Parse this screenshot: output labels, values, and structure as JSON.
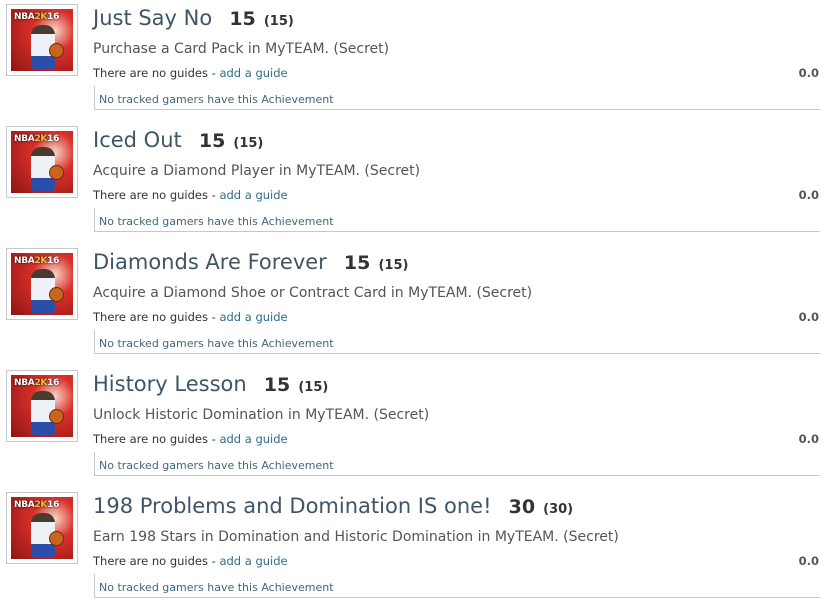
{
  "achievements": [
    {
      "title": "Just Say No",
      "score": "15",
      "score_paren": "(15)",
      "description": "Purchase a Card Pack in MyTEAM. (Secret)",
      "guides_text": "There are no guides - ",
      "guide_link": "add a guide",
      "ratio": "0.0",
      "tracked": "No tracked gamers have this Achievement"
    },
    {
      "title": "Iced Out",
      "score": "15",
      "score_paren": "(15)",
      "description": "Acquire a Diamond Player in MyTEAM. (Secret)",
      "guides_text": "There are no guides - ",
      "guide_link": "add a guide",
      "ratio": "0.0",
      "tracked": "No tracked gamers have this Achievement"
    },
    {
      "title": "Diamonds Are Forever",
      "score": "15",
      "score_paren": "(15)",
      "description": "Acquire a Diamond Shoe or Contract Card in MyTEAM. (Secret)",
      "guides_text": "There are no guides - ",
      "guide_link": "add a guide",
      "ratio": "0.0",
      "tracked": "No tracked gamers have this Achievement"
    },
    {
      "title": "History Lesson",
      "score": "15",
      "score_paren": "(15)",
      "description": "Unlock Historic Domination in MyTEAM. (Secret)",
      "guides_text": "There are no guides - ",
      "guide_link": "add a guide",
      "ratio": "0.0",
      "tracked": "No tracked gamers have this Achievement"
    },
    {
      "title": "198 Problems and Domination IS one!",
      "score": "30",
      "score_paren": "(30)",
      "description": "Earn 198 Stars in Domination and Historic Domination in MyTEAM. (Secret)",
      "guides_text": "There are no guides - ",
      "guide_link": "add a guide",
      "ratio": "0.0",
      "tracked": "No tracked gamers have this Achievement"
    }
  ],
  "game_logo": {
    "prefix": "NBA",
    "k": "2K",
    "suffix": "16"
  },
  "colors": {
    "title": "#3f5567",
    "link": "#2e6f8c",
    "divider": "#c7c7c7"
  }
}
